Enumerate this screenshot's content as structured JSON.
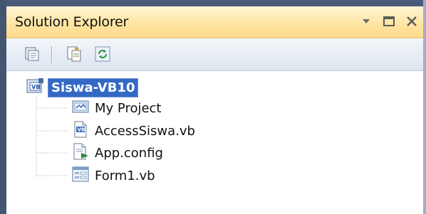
{
  "window": {
    "title": "Solution Explorer",
    "controls": [
      "dropdown-arrow-icon",
      "maximize-icon",
      "close-icon"
    ]
  },
  "toolbar": {
    "buttons": [
      "show-all-files-icon",
      "properties-icon",
      "refresh-icon"
    ]
  },
  "tree": {
    "root": {
      "label": "Siswa-VB10",
      "icon": "vb-project-icon",
      "selected": true
    },
    "children": [
      {
        "label": "My Project",
        "icon": "my-project-icon"
      },
      {
        "label": "AccessSiswa.vb",
        "icon": "vb-file-icon"
      },
      {
        "label": "App.config",
        "icon": "config-file-icon"
      },
      {
        "label": "Form1.vb",
        "icon": "form-icon"
      }
    ]
  },
  "colors": {
    "title_gradient_top": "#fff5d6",
    "title_gradient_bottom": "#ffd98a",
    "selection": "#3468c5",
    "frame": "#4a5a7a"
  }
}
